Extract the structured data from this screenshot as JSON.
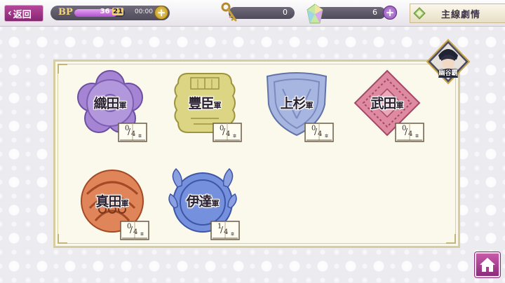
{
  "header": {
    "back_label": "返回",
    "bp": {
      "label": "BP",
      "current": "36",
      "max": "21",
      "fill_fraction": 0.85,
      "timer": "00:00"
    },
    "keys": {
      "value": "0"
    },
    "gems": {
      "value": "6"
    },
    "story_tab_label": "主線劇情"
  },
  "clans": [
    {
      "name": "織田",
      "suffix": "軍",
      "cleared": "0",
      "total": "4",
      "unit": "章",
      "color": "#a07bd0"
    },
    {
      "name": "豐臣",
      "suffix": "軍",
      "cleared": "0",
      "total": "4",
      "unit": "章",
      "color": "#d6ce7a"
    },
    {
      "name": "上杉",
      "suffix": "軍",
      "cleared": "0",
      "total": "4",
      "unit": "章",
      "color": "#9aaedc"
    },
    {
      "name": "武田",
      "suffix": "軍",
      "cleared": "0",
      "total": "4",
      "unit": "章",
      "color": "#d97c92"
    },
    {
      "name": "真田",
      "suffix": "軍",
      "cleared": "0",
      "total": "4",
      "unit": "章",
      "color": "#dd7d52"
    },
    {
      "name": "伊達",
      "suffix": "軍",
      "cleared": "1",
      "total": "4",
      "unit": "章",
      "color": "#6e88d8"
    }
  ],
  "avatar": {
    "label": "幽谷霸"
  },
  "icons": {
    "back": "chevron-left-icon",
    "key": "key-icon",
    "gem": "crystal-icon",
    "story": "diamond-icon",
    "home": "home-icon"
  }
}
